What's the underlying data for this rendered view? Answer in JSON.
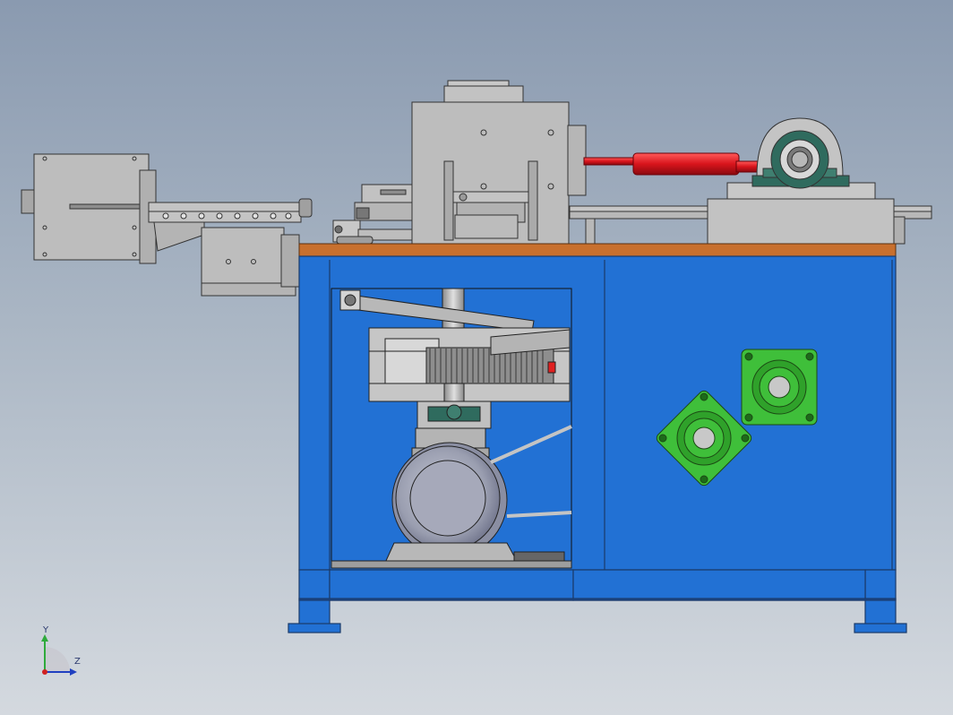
{
  "viewport": {
    "background_top": "#8a9ab0",
    "background_bottom": "#d4d9df"
  },
  "model": {
    "frame_color": "#2271d4",
    "frame_edge": "#1a3a6a",
    "top_plate_color": "#c8702e",
    "part_gray": "#bdbdbd",
    "cylinder_color": "#d8141c",
    "bearing_green": "#3fbf3a",
    "bearing_teal": "#2f6b5e"
  },
  "triad": {
    "y_label": "Y",
    "z_label": "Z",
    "icon": "coordinate-triad-icon"
  }
}
